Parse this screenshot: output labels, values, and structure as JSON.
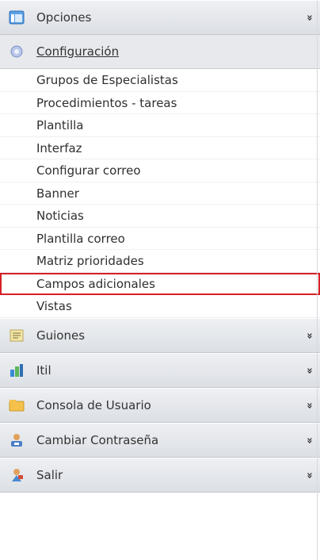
{
  "menu": {
    "opciones": {
      "label": "Opciones",
      "icon": "window-icon",
      "chevron": "»"
    },
    "configuracion": {
      "label": "Configuración",
      "icon": "gear-icon"
    },
    "submenu": [
      {
        "label": "Grupos de Especialistas"
      },
      {
        "label": "Procedimientos - tareas"
      },
      {
        "label": "Plantilla"
      },
      {
        "label": "Interfaz"
      },
      {
        "label": "Configurar correo"
      },
      {
        "label": "Banner"
      },
      {
        "label": "Noticias"
      },
      {
        "label": "Plantilla correo"
      },
      {
        "label": "Matriz prioridades"
      },
      {
        "label": "Campos adicionales",
        "highlighted": true
      },
      {
        "label": "Vistas"
      }
    ],
    "sections": [
      {
        "label": "Guiones",
        "icon": "notepad-icon",
        "chevron": "»"
      },
      {
        "label": "Itil",
        "icon": "stack-icon",
        "chevron": "»"
      },
      {
        "label": "Consola de Usuario",
        "icon": "folder-icon",
        "chevron": "»"
      },
      {
        "label": "Cambiar Contraseña",
        "icon": "user-key-icon",
        "chevron": "»"
      },
      {
        "label": "Salir",
        "icon": "exit-user-icon",
        "chevron": "»"
      }
    ]
  },
  "colors": {
    "highlight_border": "#d61f26",
    "header_bg": "#e2e5e9"
  }
}
